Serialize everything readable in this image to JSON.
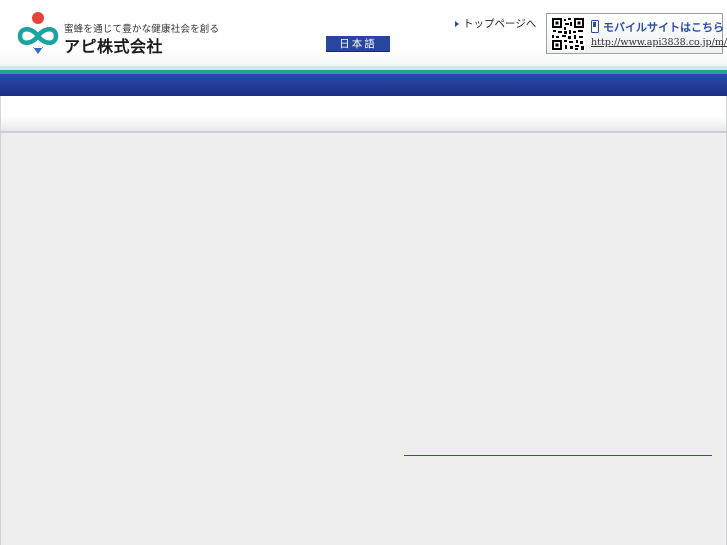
{
  "header": {
    "tagline": "蜜蜂を通じて豊かな健康社会を創る",
    "company_name": "アピ株式会社",
    "language_label": "日本語",
    "top_page_link": "トップページへ",
    "mobile": {
      "title": "モバイルサイトはこちら",
      "url": "http://www.api3838.co.jp/m/"
    }
  },
  "colors": {
    "brand_blue": "#2a45a0",
    "accent_green": "#2e9f8a",
    "logo_red": "#e5443a",
    "logo_teal": "#1aa3a0"
  },
  "icons": {
    "logo": "bee-infinity-logo-icon",
    "arrow": "triangle-arrow-icon",
    "qr": "qr-code-icon",
    "phone": "mobile-phone-icon"
  }
}
